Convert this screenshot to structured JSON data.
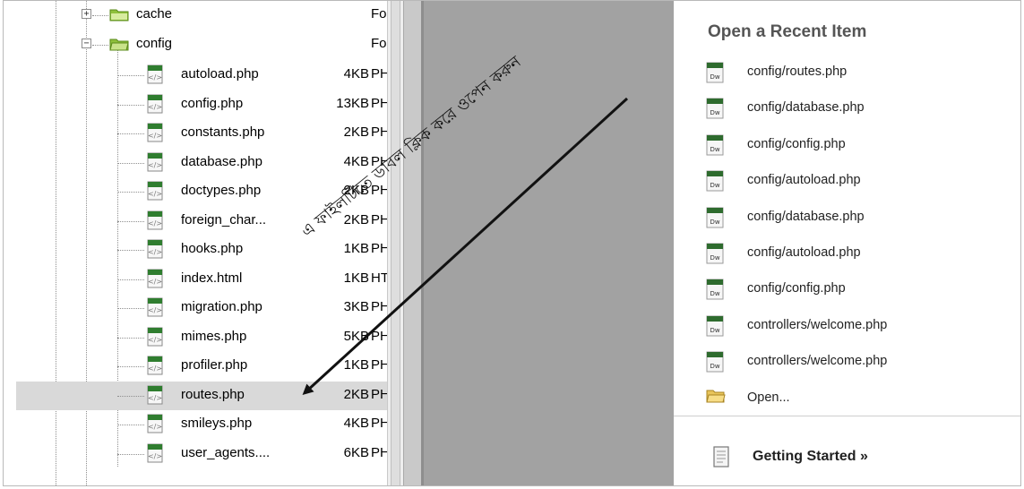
{
  "tree": {
    "folders": [
      {
        "name": "cache",
        "type": "Fol",
        "expander": "+"
      },
      {
        "name": "config",
        "type": "Fol",
        "expander": "−"
      }
    ],
    "files": [
      {
        "name": "autoload.php",
        "size": "4KB",
        "type": "PHF"
      },
      {
        "name": "config.php",
        "size": "13KB",
        "type": "PHF"
      },
      {
        "name": "constants.php",
        "size": "2KB",
        "type": "PHF"
      },
      {
        "name": "database.php",
        "size": "4KB",
        "type": "PHF"
      },
      {
        "name": "doctypes.php",
        "size": "2KB",
        "type": "PHF"
      },
      {
        "name": "foreign_char...",
        "size": "2KB",
        "type": "PHF"
      },
      {
        "name": "hooks.php",
        "size": "1KB",
        "type": "PHF"
      },
      {
        "name": "index.html",
        "size": "1KB",
        "type": "HTI"
      },
      {
        "name": "migration.php",
        "size": "3KB",
        "type": "PHF"
      },
      {
        "name": "mimes.php",
        "size": "5KB",
        "type": "PHF"
      },
      {
        "name": "profiler.php",
        "size": "1KB",
        "type": "PHF"
      },
      {
        "name": "routes.php",
        "size": "2KB",
        "type": "PHF",
        "selected": true
      },
      {
        "name": "smileys.php",
        "size": "4KB",
        "type": "PHF"
      },
      {
        "name": "user_agents....",
        "size": "6KB",
        "type": "PHF"
      }
    ]
  },
  "recent": {
    "title": "Open a Recent Item",
    "items": [
      {
        "label": "config/routes.php",
        "icon": "dw-file-icon"
      },
      {
        "label": "config/database.php",
        "icon": "dw-file-icon"
      },
      {
        "label": "config/config.php",
        "icon": "dw-file-icon"
      },
      {
        "label": "config/autoload.php",
        "icon": "dw-file-icon"
      },
      {
        "label": "config/database.php",
        "icon": "dw-file-icon"
      },
      {
        "label": "config/autoload.php",
        "icon": "dw-file-icon"
      },
      {
        "label": "config/config.php",
        "icon": "dw-file-icon"
      },
      {
        "label": "controllers/welcome.php",
        "icon": "dw-file-icon"
      },
      {
        "label": "controllers/welcome.php",
        "icon": "dw-file-icon"
      },
      {
        "label": "Open...",
        "icon": "folder-open-icon"
      }
    ],
    "getting_started": "Getting Started »"
  },
  "annotation": {
    "text": "এ ফাইলটিতে ডাবল ক্লিক করে ওপেন করুন",
    "color": "#111111"
  },
  "colors": {
    "selected_row": "#d9d9d9",
    "mid_pane": "#a2a2a2",
    "folder": "#8fc03c",
    "php_icon": "#2f7d2f",
    "dw_icon": "#2e6b2e"
  }
}
